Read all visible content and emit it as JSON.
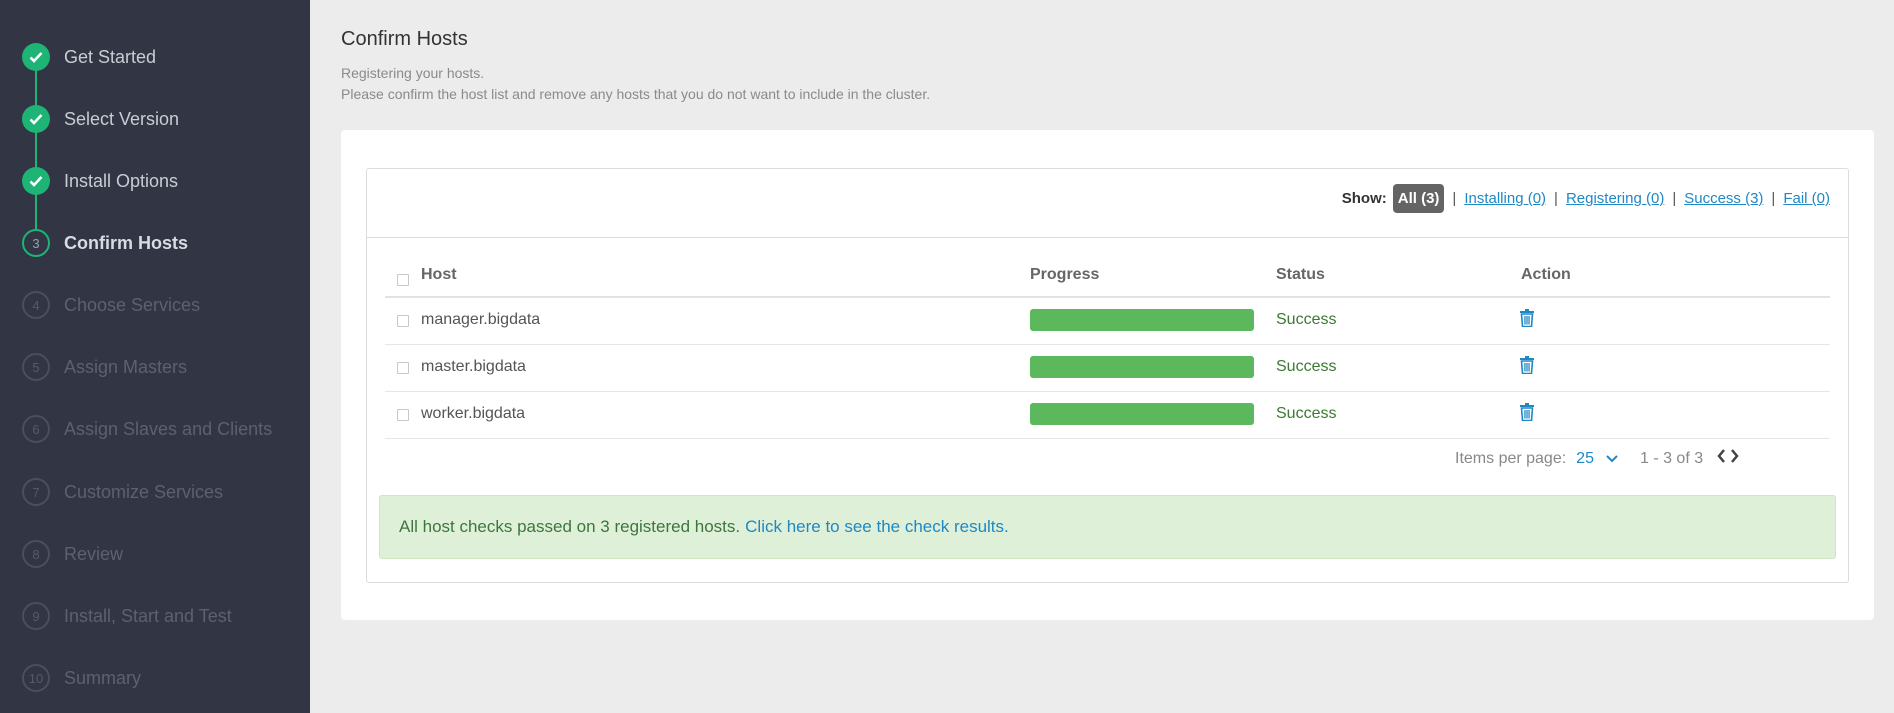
{
  "steps": [
    {
      "label": "Get Started",
      "num": "",
      "state": "done"
    },
    {
      "label": "Select Version",
      "num": "",
      "state": "done"
    },
    {
      "label": "Install Options",
      "num": "",
      "state": "done"
    },
    {
      "label": "Confirm Hosts",
      "num": "3",
      "state": "current"
    },
    {
      "label": "Choose Services",
      "num": "4",
      "state": "todo"
    },
    {
      "label": "Assign Masters",
      "num": "5",
      "state": "todo"
    },
    {
      "label": "Assign Slaves and Clients",
      "num": "6",
      "state": "todo"
    },
    {
      "label": "Customize Services",
      "num": "7",
      "state": "todo"
    },
    {
      "label": "Review",
      "num": "8",
      "state": "todo"
    },
    {
      "label": "Install, Start and Test",
      "num": "9",
      "state": "todo"
    },
    {
      "label": "Summary",
      "num": "10",
      "state": "todo"
    }
  ],
  "page": {
    "title": "Confirm Hosts",
    "subtitle_1": "Registering your hosts.",
    "subtitle_2": "Please confirm the host list and remove any hosts that you do not want to include in the cluster."
  },
  "filter": {
    "show_label": "Show:",
    "all": "All (3)",
    "installing": "Installing (0)",
    "registering": "Registering (0)",
    "success": "Success (3)",
    "fail": "Fail (0)",
    "separator": "|"
  },
  "table": {
    "columns": {
      "host": "Host",
      "progress": "Progress",
      "status": "Status",
      "action": "Action"
    },
    "rows": [
      {
        "host": "manager.bigdata",
        "progress": 100,
        "status": "Success",
        "action_icon": "trash-icon"
      },
      {
        "host": "master.bigdata",
        "progress": 100,
        "status": "Success",
        "action_icon": "trash-icon"
      },
      {
        "host": "worker.bigdata",
        "progress": 100,
        "status": "Success",
        "action_icon": "trash-icon"
      }
    ]
  },
  "pager": {
    "items_label": "Items per page:",
    "per_page": "25",
    "range": "1 - 3 of 3"
  },
  "alert": {
    "message": "All host checks passed on 3 registered hosts.",
    "link": "Click here to see the check results."
  },
  "colors": {
    "sidebar_bg": "#313544",
    "step_done": "#1eb475",
    "progress_bar": "#5cb85c",
    "link": "#1f88c5",
    "alert_bg": "#dff0d8"
  }
}
